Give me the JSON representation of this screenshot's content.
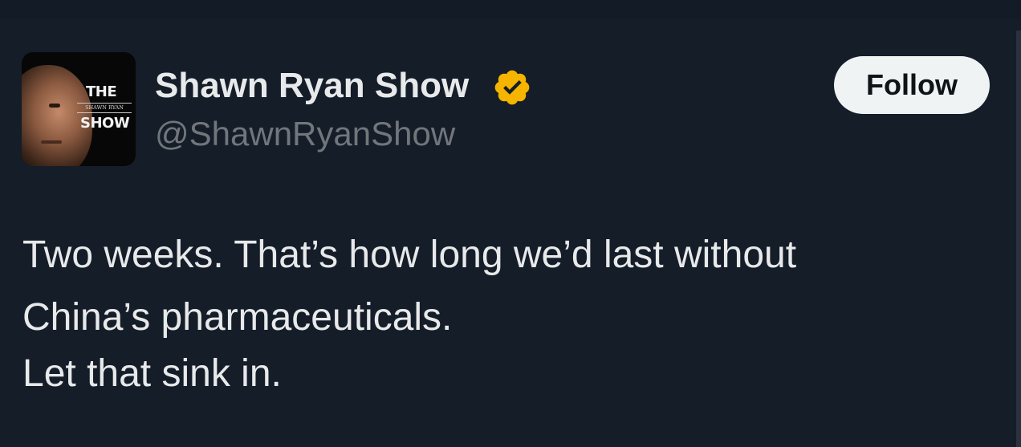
{
  "account": {
    "display_name": "Shawn Ryan Show",
    "handle": "@ShawnRyanShow",
    "verified_badge_color": "#f4b400",
    "avatar_logo": {
      "top": "THE",
      "middle": "SHAWN RYAN",
      "bottom": "SHOW"
    }
  },
  "actions": {
    "follow_label": "Follow"
  },
  "tweet": {
    "lines": [
      "Two weeks. That’s how long we’d last without",
      "China’s pharmaceuticals.",
      "Let that sink in."
    ]
  },
  "colors": {
    "background": "#151d29",
    "primary_text": "#e7e9ea",
    "secondary_text": "#71767b",
    "button_bg": "#eff3f4"
  }
}
